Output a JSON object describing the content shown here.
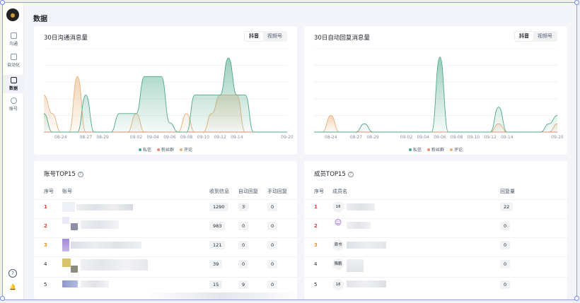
{
  "sidebar": {
    "items": [
      {
        "label": "沟通",
        "icon": "chat-icon"
      },
      {
        "label": "自动化",
        "icon": "automation-icon"
      },
      {
        "label": "数据",
        "icon": "data-icon",
        "active": true
      },
      {
        "label": "账号",
        "icon": "account-icon"
      }
    ],
    "help_glyph": "?",
    "bell_glyph": "🔔"
  },
  "page": {
    "title": "数据"
  },
  "colors": {
    "private_msg": "#4aa88a",
    "fans_group": "#e98b6e",
    "comment": "#e9b07a"
  },
  "chart1": {
    "title": "30日沟通消息量",
    "tabs": [
      "抖音",
      "视频号"
    ],
    "active_tab": "抖音",
    "legend": [
      "私信",
      "粉丝群",
      "评论"
    ]
  },
  "chart2": {
    "title": "30日自动回复消息量",
    "tabs": [
      "抖音",
      "视频号"
    ],
    "active_tab": "抖音",
    "legend": [
      "私信",
      "粉丝群",
      "评论"
    ]
  },
  "chart_data": [
    {
      "type": "area",
      "title": "30日沟通消息量",
      "x": [
        "08-22",
        "08-23",
        "08-24",
        "08-25",
        "08-26",
        "08-27",
        "08-28",
        "08-29",
        "08-30",
        "08-31",
        "09-01",
        "09-02",
        "09-03",
        "09-04",
        "09-05",
        "09-06",
        "09-07",
        "09-08",
        "09-09",
        "09-10",
        "09-11",
        "09-12",
        "09-13",
        "09-14",
        "09-15",
        "09-16",
        "09-17",
        "09-18",
        "09-19",
        "09-20"
      ],
      "x_tick_labels": [
        "08-24",
        "08-27",
        "08-29",
        "09-02",
        "09-04",
        "09-06",
        "09-08",
        "09-10",
        "09-12",
        "09-14",
        "09-20"
      ],
      "series": [
        {
          "name": "私信",
          "values": [
            2,
            0,
            0,
            0,
            0,
            4,
            0,
            0,
            0,
            2,
            2,
            2,
            6,
            6,
            6,
            1,
            0,
            0,
            4,
            4,
            4,
            4,
            8,
            4,
            4,
            0,
            0,
            0,
            0,
            0
          ]
        },
        {
          "name": "粉丝群",
          "values": [
            0,
            0,
            0,
            0,
            0,
            0,
            0,
            0,
            0,
            0,
            0,
            0,
            0,
            0,
            0,
            0,
            0,
            0,
            0,
            0,
            0,
            0,
            0,
            0,
            0,
            0,
            0,
            0,
            0,
            0
          ]
        },
        {
          "name": "评论",
          "values": [
            4,
            2,
            0,
            0,
            6,
            0,
            0,
            0,
            0,
            0,
            0,
            2,
            0,
            0,
            0,
            0,
            0,
            2,
            0,
            0,
            2,
            4,
            4,
            4,
            0,
            0,
            0,
            0,
            0,
            0
          ]
        }
      ],
      "ylim": [
        0,
        9
      ],
      "legend_position": "bottom-center",
      "grid": true
    },
    {
      "type": "area",
      "title": "30日自动回复消息量",
      "x": [
        "08-22",
        "08-23",
        "08-24",
        "08-25",
        "08-26",
        "08-27",
        "08-28",
        "08-29",
        "08-30",
        "08-31",
        "09-01",
        "09-02",
        "09-03",
        "09-04",
        "09-05",
        "09-06",
        "09-07",
        "09-08",
        "09-09",
        "09-10",
        "09-11",
        "09-12",
        "09-13",
        "09-14",
        "09-15",
        "09-16",
        "09-17",
        "09-18",
        "09-19",
        "09-20"
      ],
      "x_tick_labels": [
        "08-24",
        "08-27",
        "08-29",
        "09-02",
        "09-04",
        "09-06",
        "09-08",
        "09-10",
        "09-12",
        "09-14",
        "09-20"
      ],
      "series": [
        {
          "name": "私信",
          "values": [
            0,
            0,
            0,
            0,
            0,
            0,
            1,
            0,
            0,
            0,
            0,
            0,
            0,
            0,
            0,
            9,
            0,
            0,
            0,
            0,
            0,
            0,
            3,
            0,
            0,
            0,
            0,
            0,
            1,
            2
          ]
        },
        {
          "name": "粉丝群",
          "values": [
            0,
            0,
            0,
            0,
            0,
            0,
            0,
            0,
            0,
            0,
            0,
            0,
            0,
            0,
            0,
            0,
            0,
            0,
            0,
            0,
            0,
            0,
            0,
            0,
            0,
            0,
            0,
            0,
            0,
            0
          ]
        },
        {
          "name": "评论",
          "values": [
            0,
            0,
            2,
            0,
            0,
            0,
            0,
            0,
            0,
            0,
            0,
            0,
            0,
            0,
            0,
            0,
            0,
            0,
            0,
            0,
            0,
            0,
            1,
            0,
            0,
            0,
            0,
            0,
            0,
            1
          ]
        }
      ],
      "ylim": [
        0,
        10
      ],
      "legend_position": "bottom-center",
      "grid": true
    }
  ],
  "accounts_table": {
    "title": "账号TOP15",
    "help_glyph": "?",
    "headers": [
      "序号",
      "账号",
      "收到信息",
      "自动回复",
      "手动回复"
    ],
    "rows": [
      {
        "rank": "1",
        "received": "1290",
        "auto": "3",
        "manual": "0"
      },
      {
        "rank": "2",
        "received": "983",
        "auto": "0",
        "manual": "0"
      },
      {
        "rank": "3",
        "received": "121",
        "auto": "0",
        "manual": "0"
      },
      {
        "rank": "4",
        "received": "39",
        "auto": "0",
        "manual": "0"
      },
      {
        "rank": "5",
        "received": "15",
        "auto": "9",
        "manual": "0"
      }
    ]
  },
  "members_table": {
    "title": "成员TOP15",
    "help_glyph": "?",
    "headers": [
      "序号",
      "成员名",
      "回复量"
    ],
    "rows": [
      {
        "rank": "1",
        "avatar_text": "18",
        "replies": "22"
      },
      {
        "rank": "2",
        "avatar_text": "",
        "replies": "0"
      },
      {
        "rank": "3",
        "avatar_text": "周书",
        "replies": "0"
      },
      {
        "rank": "4",
        "avatar_text": "豫鹏",
        "replies": "0"
      },
      {
        "rank": "5",
        "avatar_text": "18",
        "replies": "0"
      }
    ]
  }
}
